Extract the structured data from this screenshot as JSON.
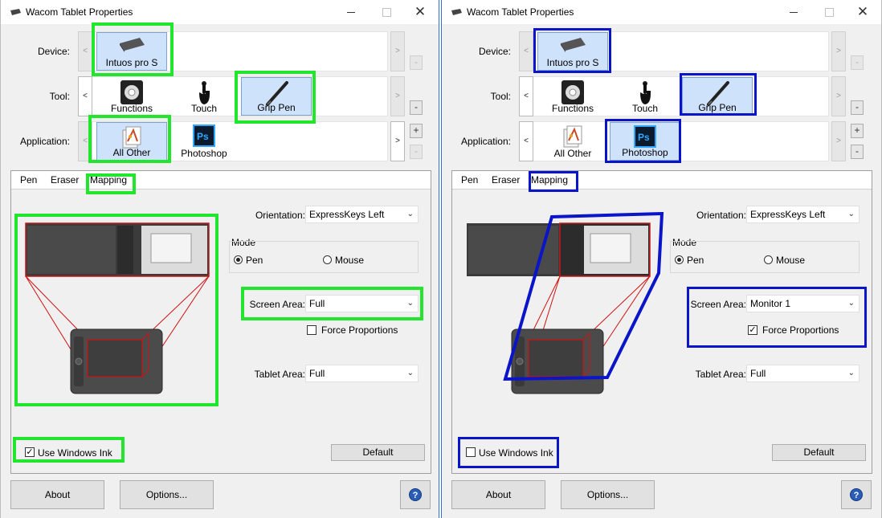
{
  "left": {
    "title": "Wacom Tablet Properties",
    "device": {
      "label": "Device:",
      "items": [
        "Intuos pro S"
      ]
    },
    "tool": {
      "label": "Tool:",
      "items": [
        "Functions",
        "Touch",
        "Grip Pen"
      ]
    },
    "application": {
      "label": "Application:",
      "items": [
        "All Other",
        "Photoshop"
      ]
    },
    "tabs": [
      "Pen",
      "Eraser",
      "Mapping"
    ],
    "orientation": {
      "label": "Orientation:",
      "value": "ExpressKeys Left"
    },
    "mode": {
      "label": "Mode",
      "options": [
        "Pen",
        "Mouse"
      ],
      "selected": "Pen"
    },
    "screen_area": {
      "label": "Screen Area:",
      "value": "Full"
    },
    "force_proportions": {
      "label": "Force Proportions",
      "checked": false
    },
    "tablet_area": {
      "label": "Tablet Area:",
      "value": "Full"
    },
    "windows_ink": {
      "label": "Use Windows Ink",
      "checked": true
    },
    "buttons": {
      "default": "Default",
      "about": "About",
      "options": "Options..."
    },
    "side_buttons": {
      "plus": "+",
      "minus": "-",
      "left_arrow": "<",
      "right_arrow": ">"
    }
  },
  "right": {
    "title": "Wacom Tablet Properties",
    "device": {
      "label": "Device:",
      "items": [
        "Intuos pro S"
      ]
    },
    "tool": {
      "label": "Tool:",
      "items": [
        "Functions",
        "Touch",
        "Grip Pen"
      ]
    },
    "application": {
      "label": "Application:",
      "items": [
        "All Other",
        "Photoshop"
      ]
    },
    "tabs": [
      "Pen",
      "Eraser",
      "Mapping"
    ],
    "orientation": {
      "label": "Orientation:",
      "value": "ExpressKeys Left"
    },
    "mode": {
      "label": "Mode",
      "options": [
        "Pen",
        "Mouse"
      ],
      "selected": "Pen"
    },
    "screen_area": {
      "label": "Screen Area:",
      "value": "Monitor 1"
    },
    "force_proportions": {
      "label": "Force Proportions",
      "checked": true
    },
    "tablet_area": {
      "label": "Tablet Area:",
      "value": "Full"
    },
    "windows_ink": {
      "label": "Use Windows Ink",
      "checked": false
    },
    "buttons": {
      "default": "Default",
      "about": "About",
      "options": "Options..."
    },
    "side_buttons": {
      "plus": "+",
      "minus": "-",
      "left_arrow": "<",
      "right_arrow": ">"
    }
  },
  "colors": {
    "left_highlight": "#22e62e",
    "right_highlight": "#0a14c8",
    "selected_item_bg": "#cfe2fb",
    "mapping_lines": "#d01010"
  },
  "icons": {
    "title": "wacom-tablet-icon",
    "device": "tablet-icon",
    "functions": "radial-menu-icon",
    "touch": "hand-touch-icon",
    "grip_pen": "pen-icon",
    "all_other": "generic-app-icon",
    "photoshop": "photoshop-icon",
    "help": "help-icon"
  }
}
